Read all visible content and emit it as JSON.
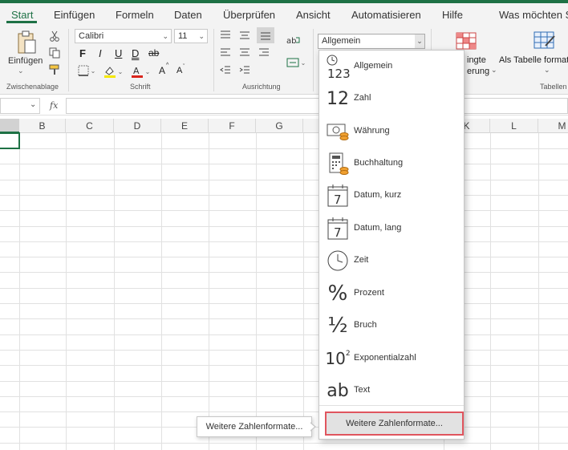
{
  "tabs": [
    {
      "label": "Start",
      "active": true
    },
    {
      "label": "Einfügen"
    },
    {
      "label": "Formeln"
    },
    {
      "label": "Daten"
    },
    {
      "label": "Überprüfen"
    },
    {
      "label": "Ansicht"
    },
    {
      "label": "Automatisieren"
    },
    {
      "label": "Hilfe"
    },
    {
      "label": "Was möchten Sie"
    }
  ],
  "ribbon": {
    "clipboard": {
      "paste_label": "Einfügen",
      "group_label": "Zwischenablage"
    },
    "font": {
      "font_name": "Calibri",
      "font_size": "11",
      "bold": "F",
      "italic": "I",
      "underline": "U",
      "double_underline": "D",
      "strikethrough": "ab",
      "grow_font": "A",
      "shrink_font": "A",
      "group_label": "Schrift"
    },
    "alignment": {
      "group_label": "Ausrichtung"
    },
    "number": {
      "format_value": "Allgemein"
    },
    "conditional": {
      "label_line1": "ingte",
      "label_line2": "erung"
    },
    "table": {
      "label": "Als Tabelle formatieren",
      "group_label": "Tabellen"
    }
  },
  "formula_bar": {
    "fx_label": "fx",
    "value": ""
  },
  "columns": [
    "",
    "B",
    "C",
    "D",
    "E",
    "F",
    "G",
    "",
    "",
    "K",
    "L",
    "M"
  ],
  "number_formats": [
    {
      "label": "Allgemein",
      "icon": "general-format-icon",
      "glyph": "123"
    },
    {
      "label": "Zahl",
      "icon": "number-format-icon",
      "glyph": "12"
    },
    {
      "label": "Währung",
      "icon": "currency-format-icon",
      "glyph": ""
    },
    {
      "label": "Buchhaltung",
      "icon": "accounting-format-icon",
      "glyph": ""
    },
    {
      "label": "Datum, kurz",
      "icon": "short-date-icon",
      "glyph": "7"
    },
    {
      "label": "Datum, lang",
      "icon": "long-date-icon",
      "glyph": "7"
    },
    {
      "label": "Zeit",
      "icon": "clock-icon",
      "glyph": ""
    },
    {
      "label": "Prozent",
      "icon": "percent-icon",
      "glyph": "%"
    },
    {
      "label": "Bruch",
      "icon": "fraction-icon",
      "glyph": "½"
    },
    {
      "label": "Exponentialzahl",
      "icon": "scientific-icon",
      "glyph": "10"
    },
    {
      "label": "Text",
      "icon": "text-format-icon",
      "glyph": "ab"
    }
  ],
  "more_formats_label": "Weitere Zahlenformate...",
  "tooltip_label": "Weitere Zahlenformate...",
  "colors": {
    "accent": "#1e7145",
    "highlight": "#e0555e",
    "font_color_bar": "#d9251c",
    "fill_color_bar": "#f5e800"
  }
}
